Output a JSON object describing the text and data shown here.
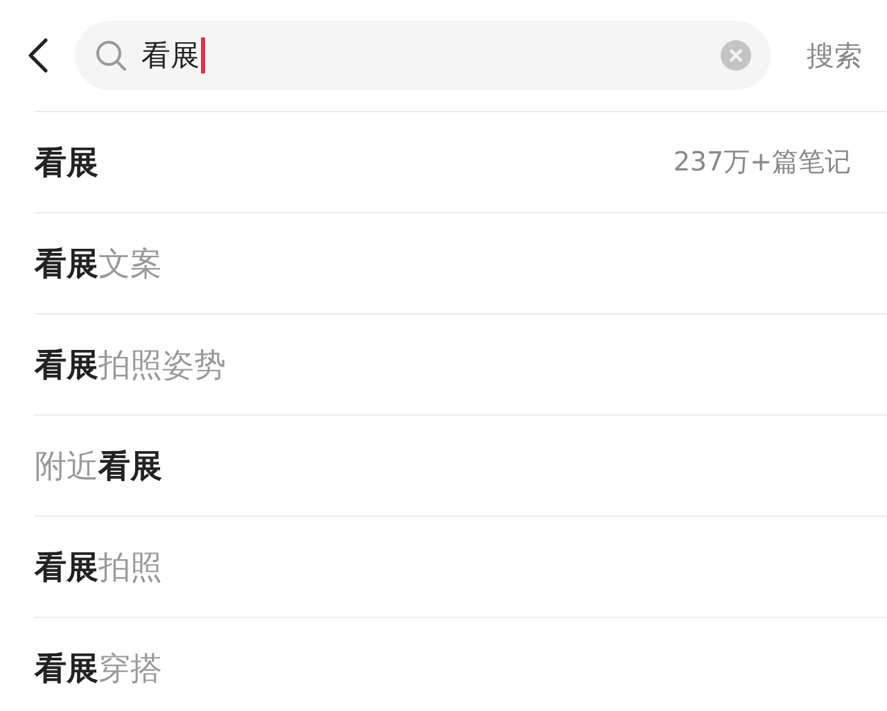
{
  "search": {
    "value": "看展",
    "focused": true,
    "button": "搜索"
  },
  "suggestions": [
    {
      "text": "**看展**",
      "count": "237万+篇笔记"
    },
    {
      "text": "**看展**文案"
    },
    {
      "text": "**看展**拍照姿势"
    },
    {
      "text": "附近**看展**"
    },
    {
      "text": "**看展**拍照"
    },
    {
      "text": "**看展**穿搭"
    }
  ]
}
